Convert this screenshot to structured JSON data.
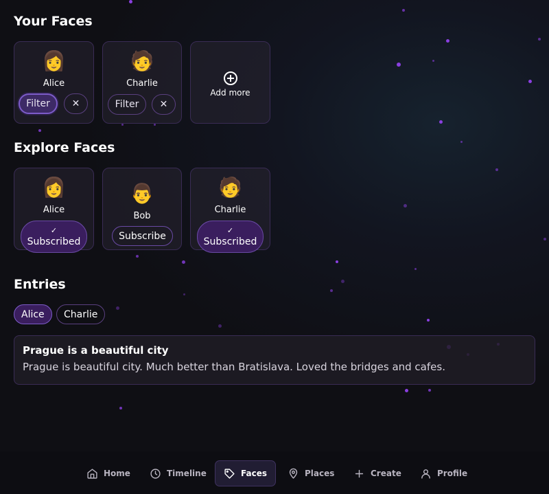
{
  "your_faces": {
    "title": "Your Faces",
    "cards": [
      {
        "emoji": "👩",
        "name": "Alice",
        "filter_label": "Filter",
        "remove_glyph": "✕",
        "filter_active": true
      },
      {
        "emoji": "🧑",
        "name": "Charlie",
        "filter_label": "Filter",
        "remove_glyph": "✕",
        "filter_active": false
      }
    ],
    "add_more_label": "Add more"
  },
  "explore_faces": {
    "title": "Explore Faces",
    "cards": [
      {
        "emoji": "👩",
        "name": "Alice",
        "button_label": "Subscribed",
        "check_glyph": "✓",
        "subscribed": true
      },
      {
        "emoji": "👨",
        "name": "Bob",
        "button_label": "Subscribe",
        "subscribed": false
      },
      {
        "emoji": "🧑",
        "name": "Charlie",
        "button_label": "Subscribed",
        "check_glyph": "✓",
        "subscribed": true
      }
    ]
  },
  "entries": {
    "title": "Entries",
    "chips": [
      {
        "label": "Alice",
        "active": true
      },
      {
        "label": "Charlie",
        "active": false
      }
    ],
    "items": [
      {
        "title": "Prague is a beautiful city",
        "body": "Prague is beautiful city. Much better than Bratislava. Loved the bridges and cafes."
      }
    ]
  },
  "nav": {
    "items": [
      {
        "label": "Home",
        "icon": "home-icon"
      },
      {
        "label": "Timeline",
        "icon": "clock-icon"
      },
      {
        "label": "Faces",
        "icon": "tag-icon",
        "active": true
      },
      {
        "label": "Places",
        "icon": "map-pin-icon"
      },
      {
        "label": "Create",
        "icon": "plus-icon"
      },
      {
        "label": "Profile",
        "icon": "user-icon"
      }
    ]
  },
  "colors": {
    "accent": "#7d5cc9",
    "accent_dark": "#3a1e5e",
    "background": "#0f0f14",
    "particle": "#8a3fe0"
  }
}
